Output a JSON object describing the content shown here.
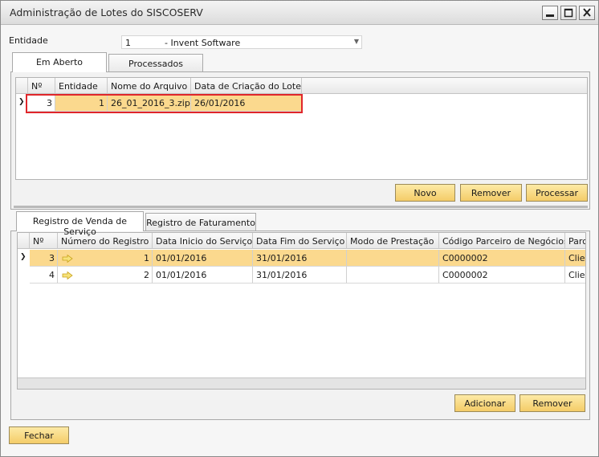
{
  "window": {
    "title": "Administração de Lotes do SISCOSERV",
    "buttons": {
      "minimize": "minimize-icon",
      "maximize": "maximize-icon",
      "close": "close-icon"
    }
  },
  "entity": {
    "label": "Entidade",
    "selected_code": "1",
    "selected_name": "- Invent Software"
  },
  "top_tabs": [
    "Em Aberto",
    "Processados"
  ],
  "lots_grid": {
    "headers": [
      "Nº",
      "Entidade",
      "Nome do Arquivo",
      "Data de Criação do Lote"
    ],
    "rows": [
      {
        "num": "3",
        "entidade": "1",
        "arquivo": "26_01_2016_3.zip",
        "data": "26/01/2016"
      }
    ]
  },
  "lot_buttons": {
    "novo": "Novo",
    "remover": "Remover",
    "processar": "Processar"
  },
  "bottom_tabs": [
    "Registro de Venda de Serviço",
    "Registro de Faturamento"
  ],
  "registros_grid": {
    "headers": [
      "Nº",
      "Número do Registro",
      "Data Inicio do Serviço",
      "Data Fim do Serviço",
      "Modo de Prestação",
      "Código Parceiro de Negócios",
      "Parc"
    ],
    "rows": [
      {
        "num": "3",
        "registro": "1",
        "inicio": "01/01/2016",
        "fim": "31/01/2016",
        "modo": "",
        "codigo": "C0000002",
        "parc": "Clien"
      },
      {
        "num": "4",
        "registro": "2",
        "inicio": "01/01/2016",
        "fim": "31/01/2016",
        "modo": "",
        "codigo": "C0000002",
        "parc": "Clien"
      }
    ]
  },
  "registro_buttons": {
    "adicionar": "Adicionar",
    "remover": "Remover"
  },
  "footer": {
    "fechar": "Fechar"
  },
  "colors": {
    "accent_button": "#f4cc68",
    "selected_row": "#fbd98e",
    "highlight_border": "#e0262b"
  }
}
